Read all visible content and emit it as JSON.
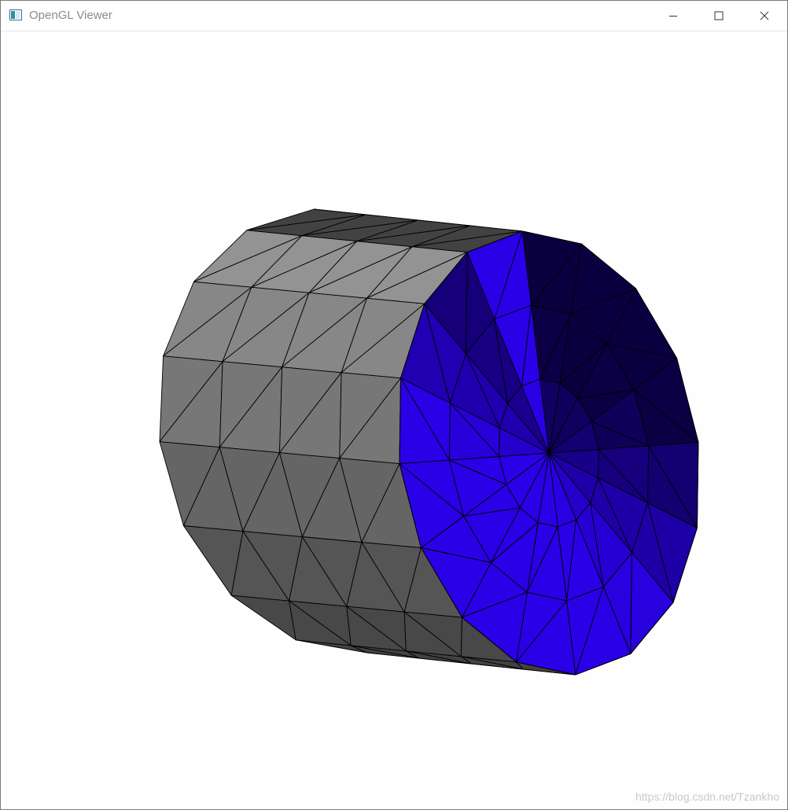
{
  "window": {
    "title": "OpenGL Viewer",
    "app_icon": "app-window-icon",
    "controls": {
      "minimize_icon": "minimize-icon",
      "maximize_icon": "maximize-icon",
      "close_icon": "close-icon"
    }
  },
  "viewport": {
    "background_color": "#fefefe",
    "mesh": {
      "side_color_light": "#9b9b9b",
      "side_color_dark": "#3c3c3c",
      "cap_color_bright": "#2a00e6",
      "cap_color_dark": "#0a0040",
      "boundary_color": "#ff1a1a",
      "edge_color": "#000000"
    }
  },
  "watermark": "https://blog.csdn.net/Tzankho"
}
